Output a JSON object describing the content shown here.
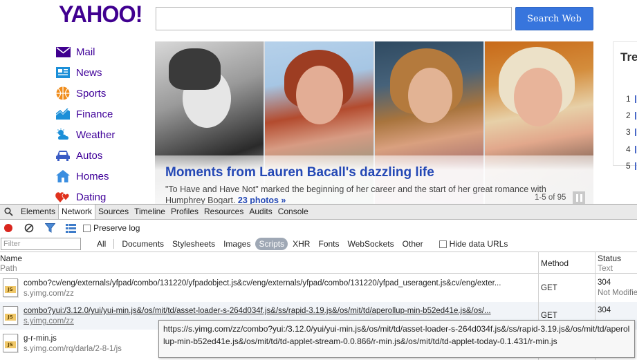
{
  "yahoo": {
    "logo": "YAHOO!",
    "search_button": "Search Web",
    "search_value": "",
    "nav": [
      {
        "label": "Mail",
        "icon": "mail-icon",
        "color": "#400090"
      },
      {
        "label": "News",
        "icon": "news-icon",
        "color": "#1b8fd8"
      },
      {
        "label": "Sports",
        "icon": "sports-icon",
        "color": "#f08c1a"
      },
      {
        "label": "Finance",
        "icon": "finance-icon",
        "color": "#1b8fd8"
      },
      {
        "label": "Weather",
        "icon": "weather-icon",
        "color": "#1b8fd8"
      },
      {
        "label": "Autos",
        "icon": "autos-icon",
        "color": "#3a5bc4"
      },
      {
        "label": "Homes",
        "icon": "homes-icon",
        "color": "#3a8ee0"
      },
      {
        "label": "Dating",
        "icon": "dating-icon",
        "color": "#e0321e"
      }
    ],
    "hero": {
      "title": "Moments from Lauren Bacall's dazzling life",
      "description": "\"To Have and Have Not\" marked the beginning of her career and the start of her great romance with Humphrey Bogart.",
      "photos_link": "23 photos »",
      "counter": "1-5 of 95"
    },
    "trending": {
      "title": "Tre",
      "numbers": [
        "1",
        "2",
        "3",
        "4",
        "5"
      ]
    }
  },
  "devtools": {
    "tabs": [
      "Elements",
      "Network",
      "Sources",
      "Timeline",
      "Profiles",
      "Resources",
      "Audits",
      "Console"
    ],
    "active_tab": "Network",
    "preserve_log": "Preserve log",
    "filter_placeholder": "Filter",
    "types": [
      "All",
      "Documents",
      "Stylesheets",
      "Images",
      "Scripts",
      "XHR",
      "Fonts",
      "WebSockets",
      "Other"
    ],
    "active_type": "Scripts",
    "hide_data_urls": "Hide data URLs",
    "columns": {
      "name": "Name",
      "path": "Path",
      "method": "Method",
      "status": "Status",
      "text": "Text"
    },
    "rows": [
      {
        "name": "combo?cv/eng/externals/yfpad/combo/131220/yfpadobject.js&cv/eng/externals/yfpad/combo/131220/yfpad_useragent.js&cv/eng/exter...",
        "domain": "s.yimg.com/zz",
        "method": "GET",
        "status": "304",
        "status_text": "Not Modified"
      },
      {
        "name": "combo?yui:/3.12.0/yui/yui-min.js&/os/mit/td/asset-loader-s-264d034f.js&/ss/rapid-3.19.js&/os/mit/td/aperollup-min-b52ed41e.js&/os/...",
        "domain": "s.yimg.com/zz",
        "method": "GET",
        "status": "304",
        "status_text": ""
      },
      {
        "name": "g-r-min.js",
        "domain": "s.yimg.com/rq/darla/2-8-1/js",
        "method": "",
        "status": "",
        "status_text": ""
      }
    ],
    "tooltip": "https://s.yimg.com/zz/combo?yui:/3.12.0/yui/yui-min.js&/os/mit/td/asset-loader-s-264d034f.js&/ss/rapid-3.19.js&/os/mit/td/aperollup-min-b52ed41e.js&/os/mit/td/td-applet-stream-0.0.866/r-min.js&/os/mit/td/td-applet-today-0.1.431/r-min.js"
  }
}
